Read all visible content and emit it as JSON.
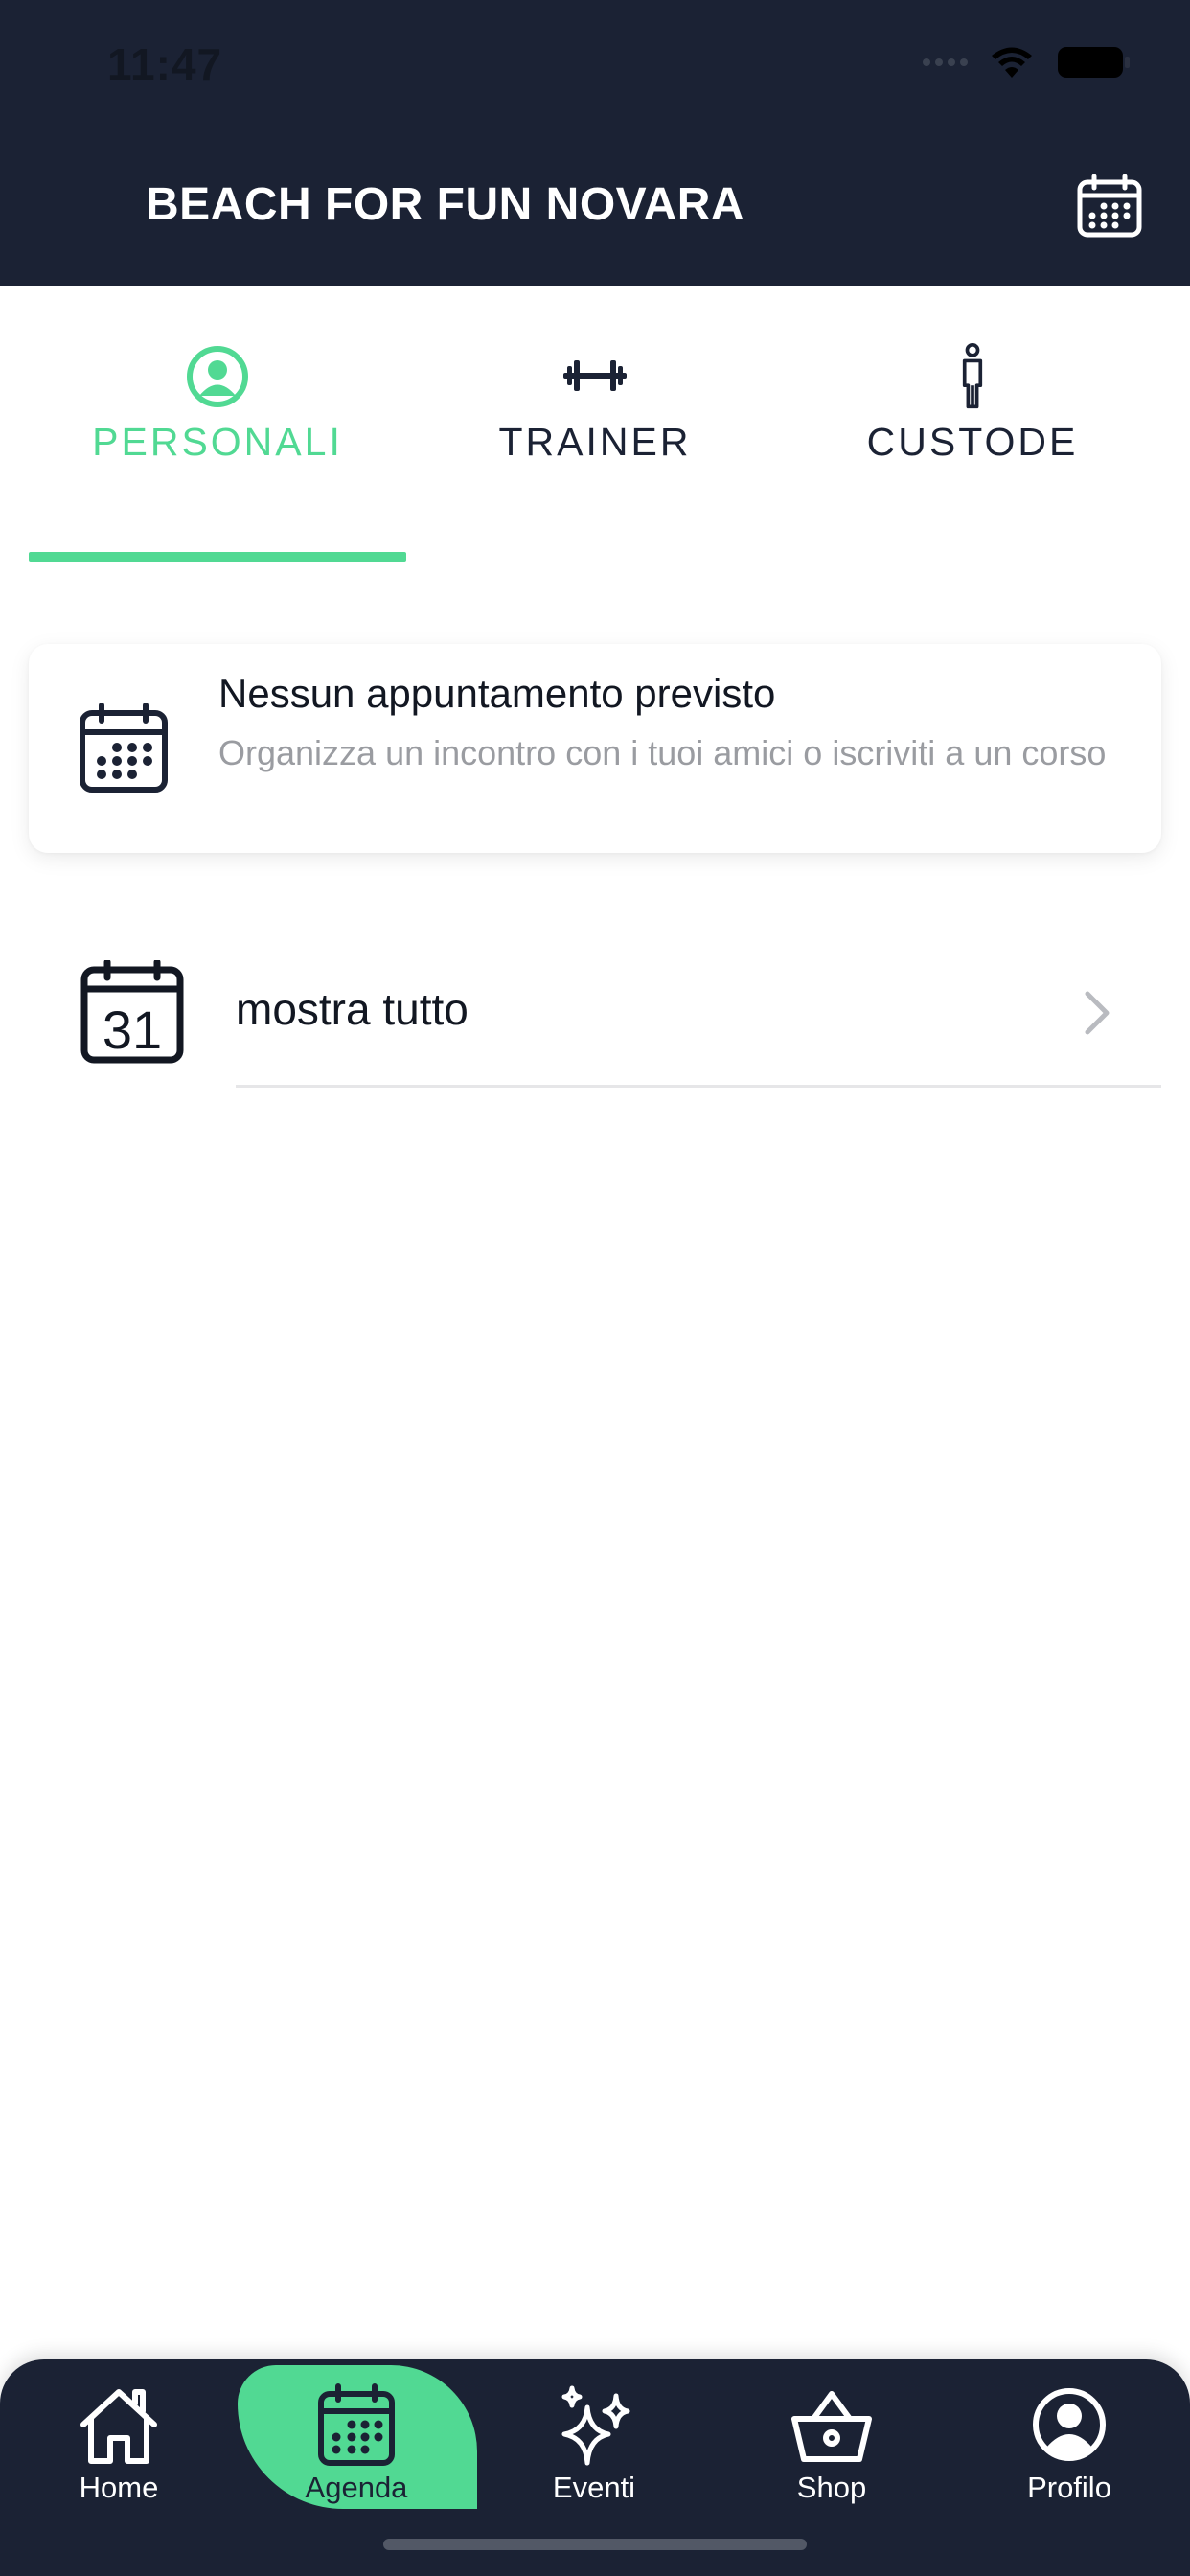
{
  "status_bar": {
    "time": "11:47"
  },
  "header": {
    "title": "BEACH FOR FUN NOVARA",
    "calendar_icon": "calendar-grid-icon"
  },
  "tabs": [
    {
      "label": "PERSONALI",
      "icon": "user-circle-icon",
      "active": true
    },
    {
      "label": "TRAINER",
      "icon": "dumbbell-icon",
      "active": false
    },
    {
      "label": "CUSTODE",
      "icon": "person-icon",
      "active": false
    }
  ],
  "card": {
    "icon": "calendar-grid-icon",
    "title": "Nessun appuntamento previsto",
    "subtitle": "Organizza un incontro con i tuoi amici o iscriviti a un corso"
  },
  "show_all": {
    "icon": "calendar-31-icon",
    "label": "mostra tutto",
    "calendar_day": "31"
  },
  "bottom_nav": [
    {
      "label": "Home",
      "icon": "home-icon",
      "active": false
    },
    {
      "label": "Agenda",
      "icon": "calendar-grid-icon",
      "active": true
    },
    {
      "label": "Eventi",
      "icon": "sparkles-icon",
      "active": false
    },
    {
      "label": "Shop",
      "icon": "basket-icon",
      "active": false
    },
    {
      "label": "Profilo",
      "icon": "user-circle-icon",
      "active": false
    }
  ],
  "colors": {
    "primary_dark": "#1b2234",
    "accent": "#51d993",
    "muted_text": "#9a9ca1"
  }
}
